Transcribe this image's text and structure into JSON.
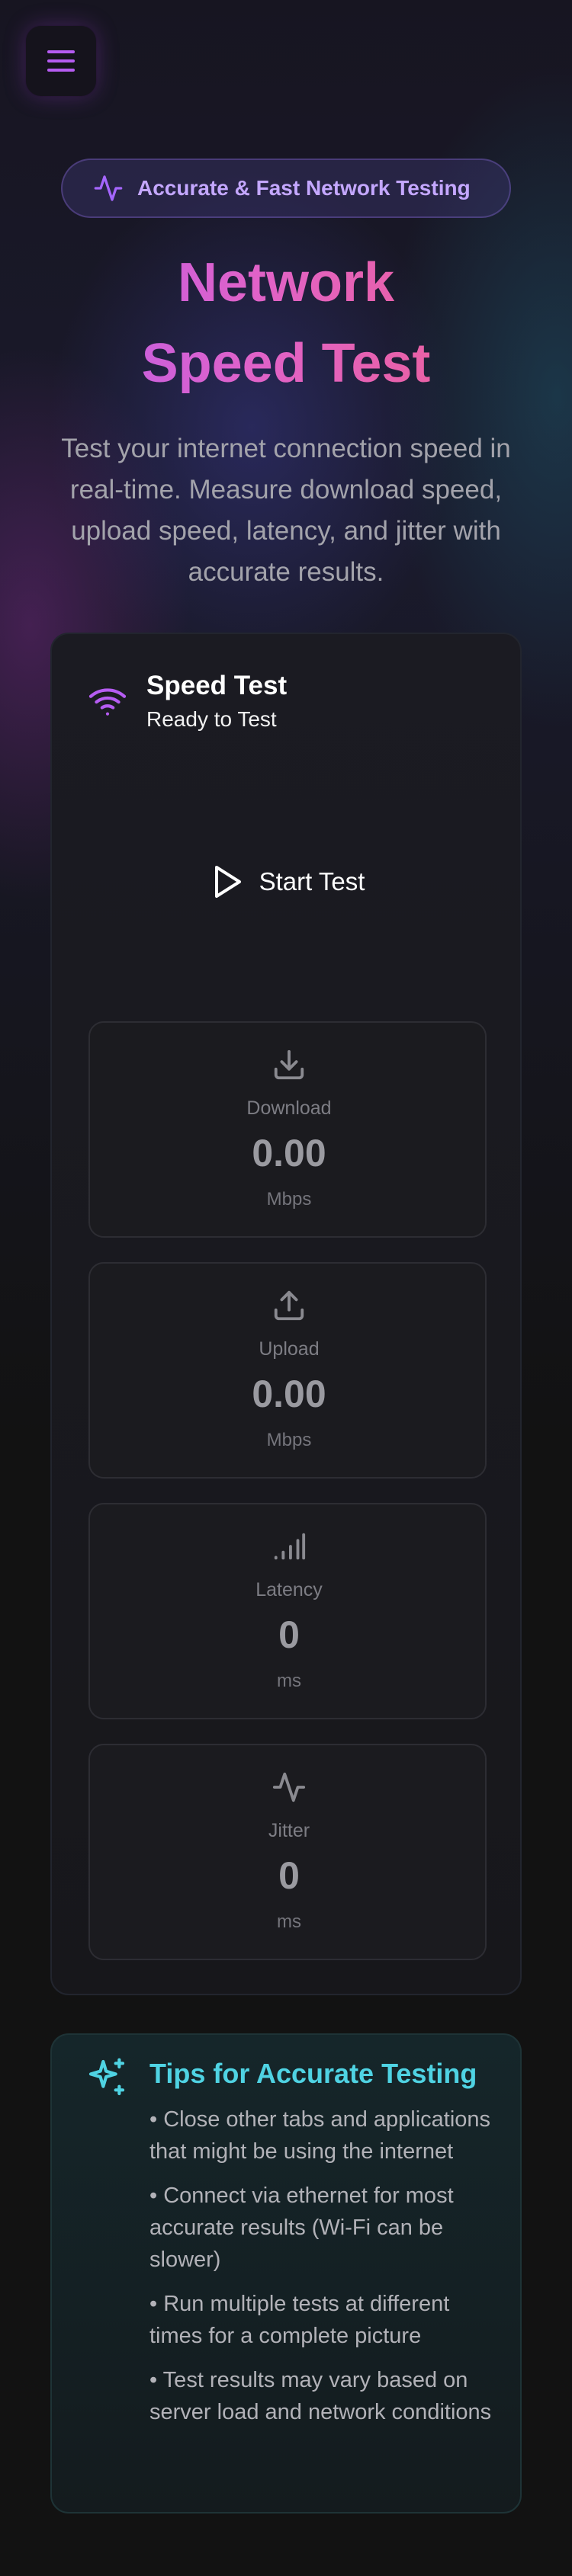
{
  "header": {
    "menu_icon": "hamburger-menu-icon",
    "badge_icon": "activity-pulse-icon",
    "badge_text": "Accurate & Fast Network Testing",
    "title_line1": "Network",
    "title_line2": "Speed Test",
    "subtitle": "Test your internet connection speed in real-time. Measure download speed, upload speed, latency, and jitter with accurate results."
  },
  "speed_card": {
    "icon": "wifi-icon",
    "title": "Speed Test",
    "status": "Ready to Test",
    "start_icon": "play-icon",
    "start_label": "Start Test",
    "metrics": [
      {
        "icon": "download-icon",
        "label": "Download",
        "value": "0.00",
        "unit": "Mbps"
      },
      {
        "icon": "upload-icon",
        "label": "Upload",
        "value": "0.00",
        "unit": "Mbps"
      },
      {
        "icon": "signal-bars-icon",
        "label": "Latency",
        "value": "0",
        "unit": "ms"
      },
      {
        "icon": "activity-pulse-icon",
        "label": "Jitter",
        "value": "0",
        "unit": "ms"
      }
    ]
  },
  "tips": {
    "icon": "sparkles-icon",
    "title": "Tips for Accurate Testing",
    "items": [
      "• Close other tabs and applications that might be using the internet",
      "• Connect via ethernet for most accurate results (Wi-Fi can be slower)",
      "• Run multiple tests at different times for a complete picture",
      "• Test results may vary based on server load and network conditions"
    ]
  },
  "colors": {
    "accent_purple": "#b45cf0",
    "accent_pink": "#f0608a",
    "accent_cyan": "#4fd3e3",
    "background": "#121212"
  }
}
